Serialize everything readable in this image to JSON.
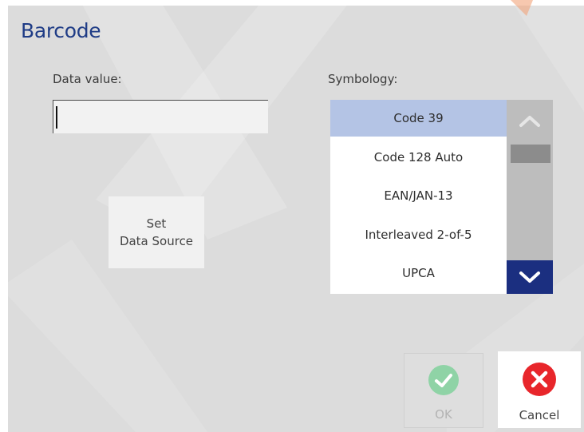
{
  "dialog": {
    "title": "Barcode",
    "data_value_label": "Data value:",
    "data_value_input": "",
    "symbology_label": "Symbology:"
  },
  "set_source": {
    "line1": "Set",
    "line2": "Data Source"
  },
  "symbology_list": {
    "items": [
      "Code 39",
      "Code 128 Auto",
      "EAN/JAN-13",
      "Interleaved 2-of-5",
      "UPCA"
    ],
    "selected": "Code 39"
  },
  "footer": {
    "ok_label": "OK",
    "cancel_label": "Cancel"
  },
  "icons": {
    "scroll_up": "chevron-up-icon",
    "scroll_down": "chevron-down-icon",
    "ok": "checkmark-icon",
    "cancel": "close-icon"
  },
  "colors": {
    "title": "#1f3c86",
    "selected_item": "#b4c4e5",
    "scroll_down_bg": "#1b2f80",
    "ok_icon": "#8fd3a6",
    "cancel_icon": "#e8262b"
  }
}
